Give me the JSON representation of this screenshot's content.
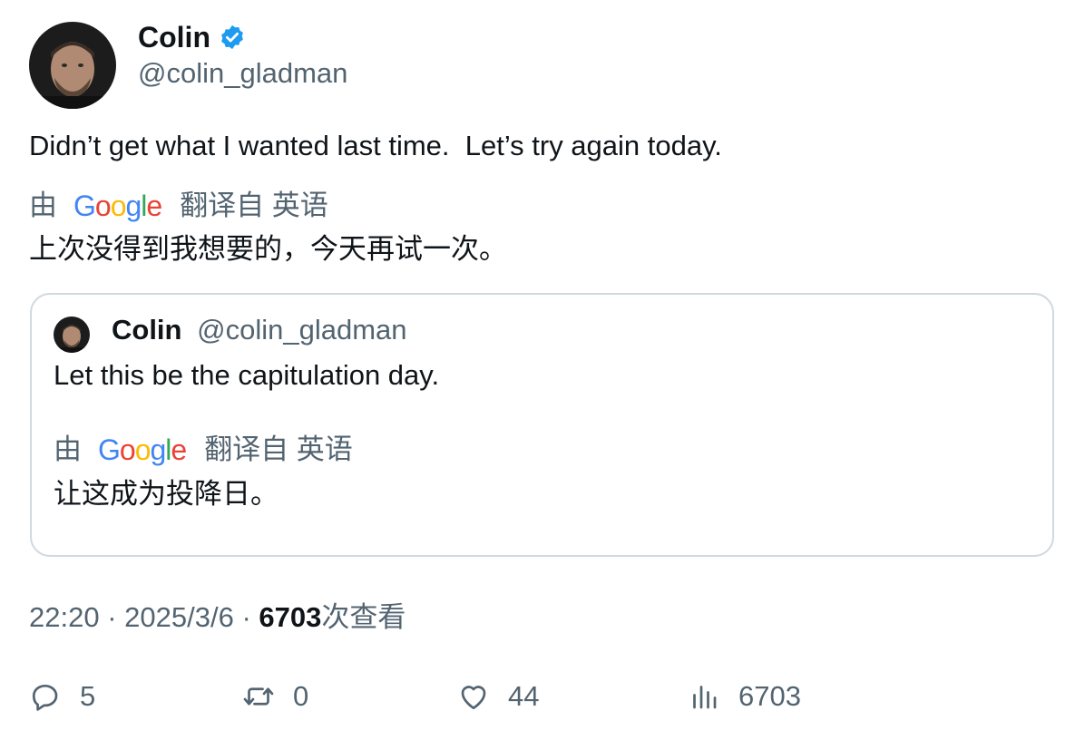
{
  "tweet": {
    "author": {
      "name": "Colin",
      "handle": "@colin_gladman",
      "verified": true,
      "verified_color": "#1d9bf0"
    },
    "text": "Didn’t get what I wanted last time.  Let’s try again today.",
    "translation": {
      "prefix": "由",
      "provider": "Google",
      "suffix": "翻译自 英语",
      "text": "上次没得到我想要的，今天再试一次。"
    },
    "quoted": {
      "name": "Colin",
      "handle": "@colin_gladman",
      "text": "Let this be the capitulation day.",
      "translation": {
        "prefix": "由",
        "provider": "Google",
        "suffix": "翻译自 英语",
        "text": "让这成为投降日。"
      }
    },
    "meta": {
      "time": "22:20",
      "separator": "·",
      "date": "2025/3/6",
      "views": "6703",
      "views_label": "次查看"
    },
    "actions": {
      "replies": "5",
      "retweets": "0",
      "likes": "44",
      "views": "6703"
    },
    "icons": [
      "verified-badge-icon",
      "reply-icon",
      "retweet-icon",
      "like-icon",
      "views-icon"
    ],
    "colors": {
      "text_primary": "#0f1419",
      "text_secondary": "#536471",
      "border": "#cfd9de",
      "google_blue": "#4285f4",
      "google_red": "#ea4335",
      "google_yellow": "#fbbc05",
      "google_green": "#34a853"
    }
  }
}
